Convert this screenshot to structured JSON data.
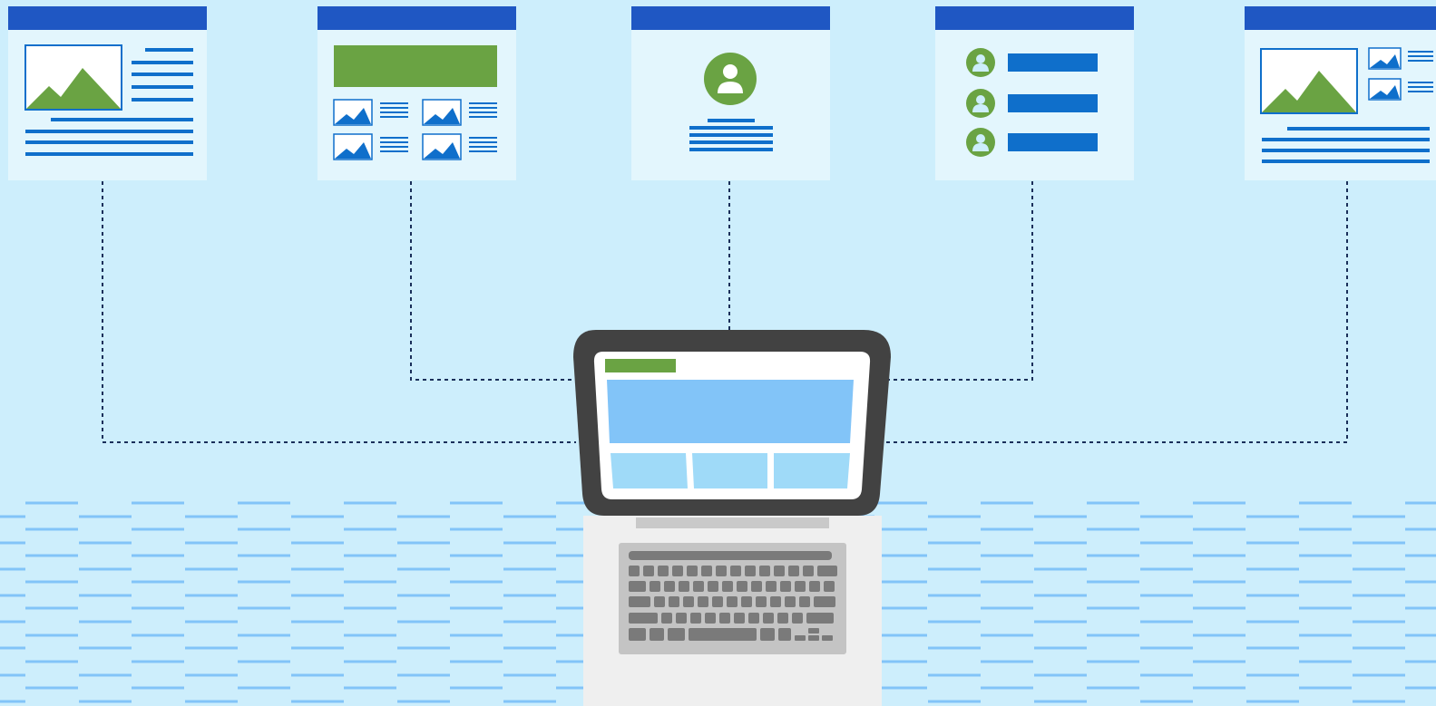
{
  "scene": {
    "description_icons": [
      "web-page-template-icon",
      "laptop-icon",
      "keyboard-icon",
      "image-icon",
      "user-avatar-icon"
    ],
    "templates": [
      {
        "id": "article-with-hero-image"
      },
      {
        "id": "gallery-grid"
      },
      {
        "id": "profile-page"
      },
      {
        "id": "user-list"
      },
      {
        "id": "image-with-thumbnails"
      }
    ]
  },
  "colors": {
    "background": "#cdeefc",
    "header_bar": "#1f57c3",
    "card": "#e3f6fd",
    "accent_blue": "#0f6fcb",
    "accent_green": "#6aa343",
    "screen_banner": "#82c4f8",
    "laptop_frame": "#424242",
    "keyboard": "#c4c4c4"
  }
}
